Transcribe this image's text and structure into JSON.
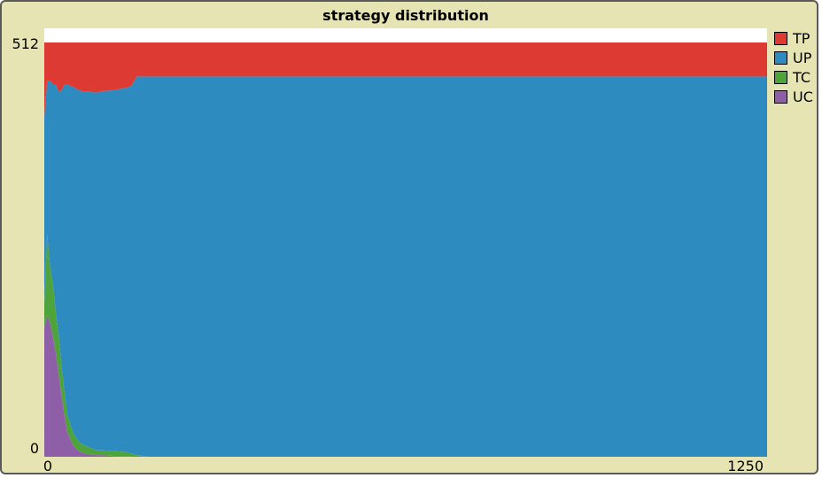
{
  "chart_data": {
    "type": "area",
    "title": "strategy distribution",
    "xlabel": "",
    "ylabel": "",
    "xlim": [
      0,
      1250
    ],
    "ylim": [
      0,
      512
    ],
    "x_tick_labels": [
      "0",
      "1250"
    ],
    "y_tick_labels": [
      "512",
      "0"
    ],
    "stacked": true,
    "legend_position": "right",
    "x": [
      0,
      5,
      10,
      15,
      20,
      25,
      30,
      35,
      40,
      50,
      60,
      70,
      80,
      90,
      100,
      120,
      140,
      150,
      160,
      180,
      200,
      300,
      600,
      900,
      1250
    ],
    "series": [
      {
        "name": "UC",
        "color": "#8e5ea6",
        "values": [
          160,
          175,
          165,
          148,
          128,
          100,
          75,
          50,
          30,
          14,
          7,
          4,
          3,
          2,
          2,
          1,
          1,
          0,
          0,
          0,
          0,
          0,
          0,
          0,
          0
        ]
      },
      {
        "name": "TC",
        "color": "#4ea43a",
        "values": [
          30,
          100,
          70,
          65,
          50,
          50,
          35,
          30,
          22,
          15,
          11,
          10,
          8,
          6,
          6,
          6,
          5,
          4,
          2,
          0,
          0,
          0,
          0,
          0,
          0
        ]
      },
      {
        "name": "UP",
        "color": "#2e8bbf",
        "values": [
          230,
          190,
          230,
          247,
          282,
          301,
          343,
          380,
          408,
          428,
          435,
          437,
          440,
          442,
          444,
          446,
          450,
          454,
          468,
          470,
          470,
          470,
          470,
          470,
          470
        ]
      },
      {
        "name": "TP",
        "color": "#dc3a32",
        "values": [
          92,
          47,
          47,
          52,
          52,
          61,
          59,
          52,
          52,
          55,
          59,
          61,
          61,
          62,
          60,
          59,
          56,
          54,
          42,
          42,
          42,
          42,
          42,
          42,
          42
        ]
      }
    ],
    "legend_order": [
      "TP",
      "UP",
      "TC",
      "UC"
    ]
  }
}
